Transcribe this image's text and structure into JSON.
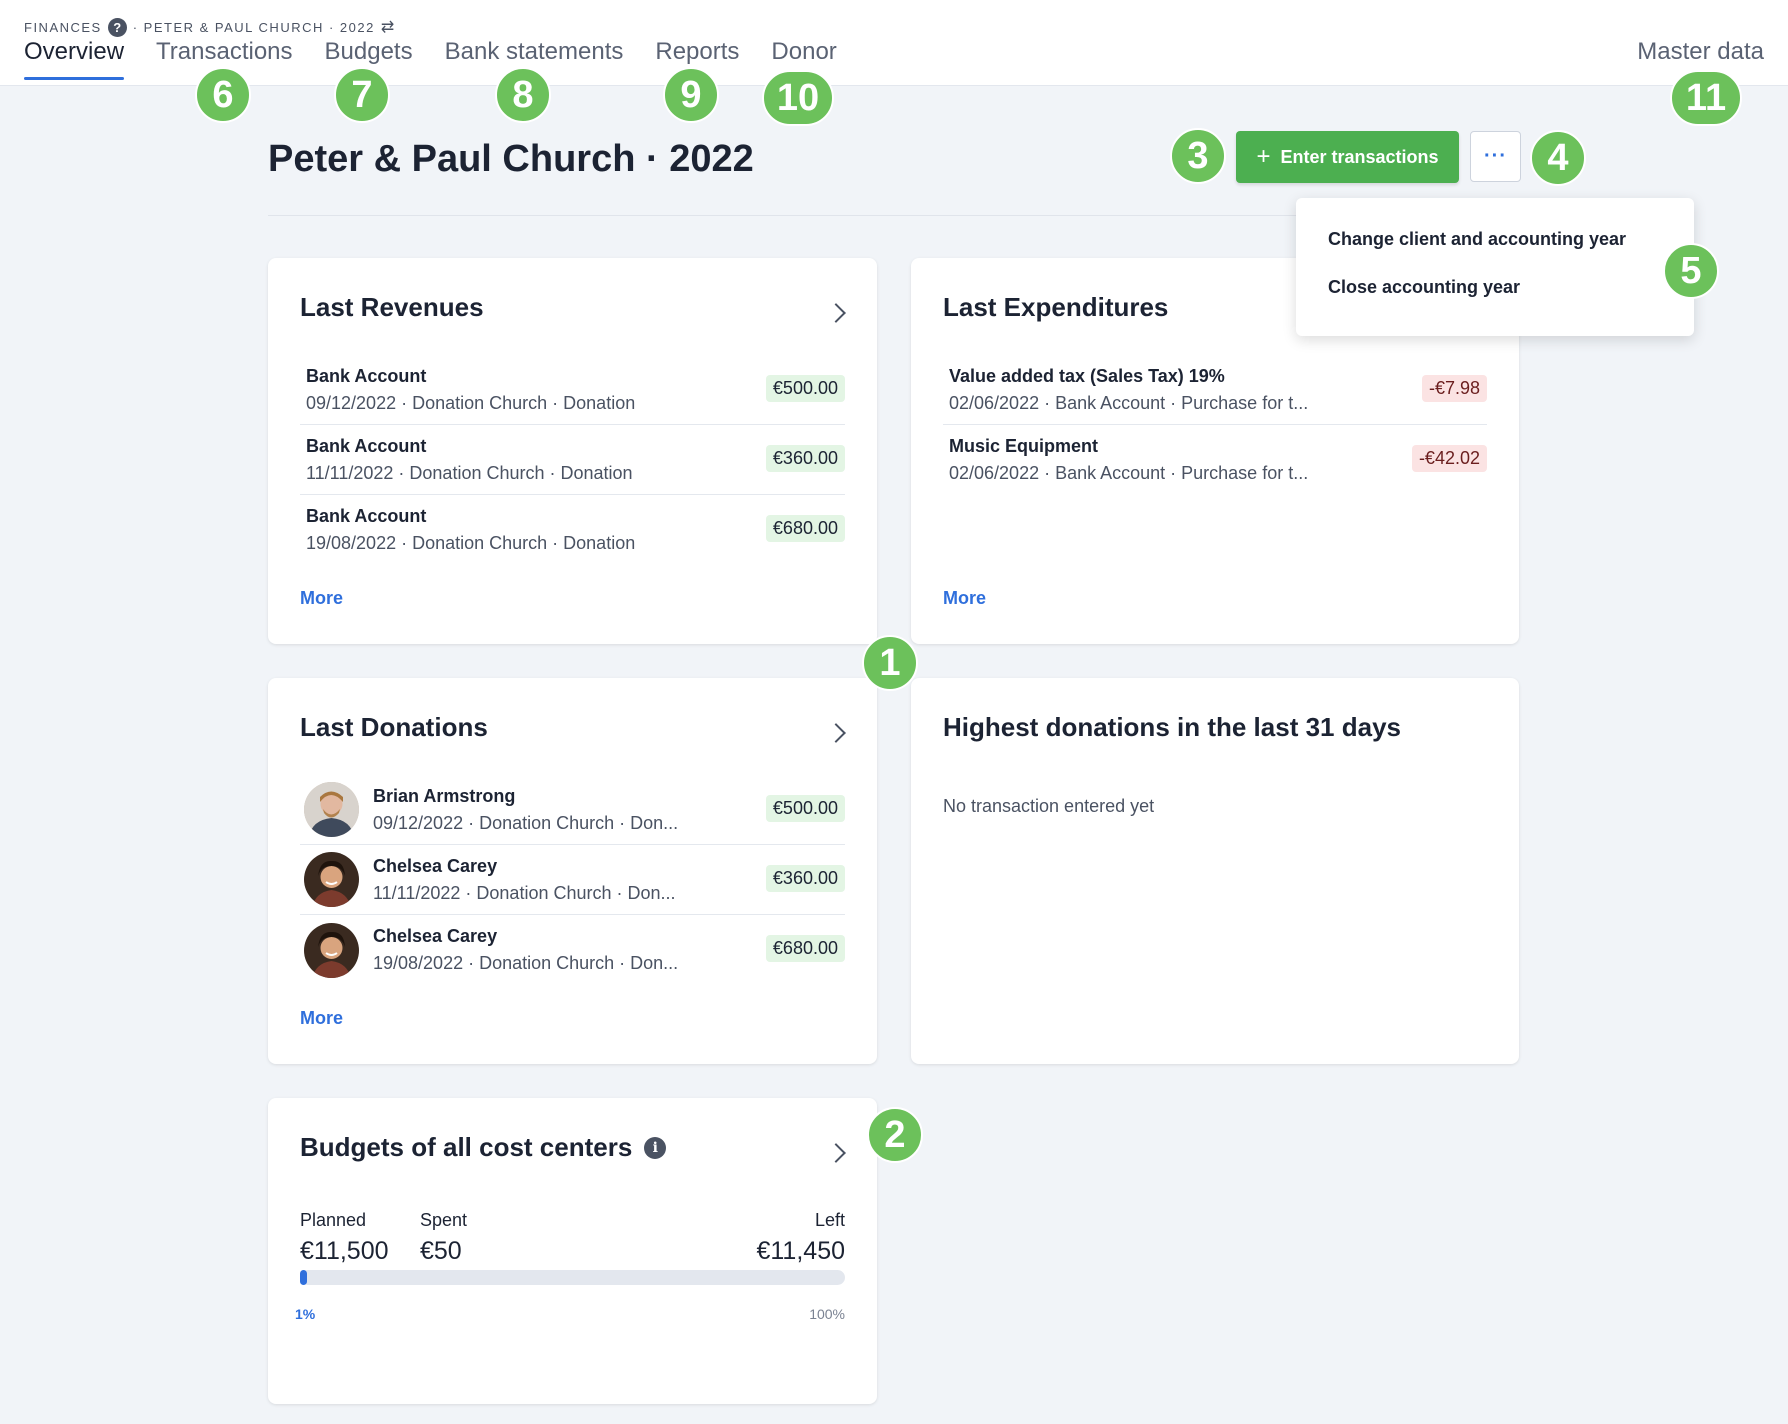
{
  "breadcrumb": {
    "section": "FINANCES",
    "help": "?",
    "client": "· PETER & PAUL CHURCH · 2022",
    "swap": "⇄"
  },
  "nav": {
    "tabs": [
      "Overview",
      "Transactions",
      "Budgets",
      "Bank statements",
      "Reports",
      "Donor"
    ],
    "right": "Master data"
  },
  "header": {
    "title": "Peter & Paul Church · 2022",
    "primary_button": "Enter transactions",
    "plus": "+",
    "more_button": "···"
  },
  "dropdown": {
    "items": [
      "Change client and accounting year",
      "Close accounting year"
    ]
  },
  "revenues": {
    "title": "Last Revenues",
    "rows": [
      {
        "title": "Bank Account",
        "sub": "09/12/2022 · Donation Church · Donation",
        "amount": "€500.00"
      },
      {
        "title": "Bank Account",
        "sub": "11/11/2022 · Donation Church · Donation",
        "amount": "€360.00"
      },
      {
        "title": "Bank Account",
        "sub": "19/08/2022 · Donation Church · Donation",
        "amount": "€680.00"
      }
    ],
    "more": "More"
  },
  "expenditures": {
    "title": "Last Expenditures",
    "rows": [
      {
        "title": "Value added tax (Sales Tax) 19%",
        "sub": "02/06/2022 · Bank Account · Purchase for t...",
        "amount": "-€7.98"
      },
      {
        "title": "Music Equipment",
        "sub": "02/06/2022 · Bank Account · Purchase for t...",
        "amount": "-€42.02"
      }
    ],
    "more": "More"
  },
  "donations": {
    "title": "Last Donations",
    "rows": [
      {
        "title": "Brian Armstrong",
        "sub": "09/12/2022 · Donation Church · Don...",
        "amount": "€500.00"
      },
      {
        "title": "Chelsea Carey",
        "sub": "11/11/2022 · Donation Church · Don...",
        "amount": "€360.00"
      },
      {
        "title": "Chelsea Carey",
        "sub": "19/08/2022 · Donation Church · Don...",
        "amount": "€680.00"
      }
    ],
    "more": "More"
  },
  "highest": {
    "title": "Highest donations in the last 31 days",
    "empty": "No transaction entered yet"
  },
  "budgets": {
    "title": "Budgets of all cost centers",
    "info": "i",
    "planned_label": "Planned",
    "planned_value": "€11,500",
    "spent_label": "Spent",
    "spent_value": "€50",
    "left_label": "Left",
    "left_value": "€11,450",
    "progress_fraction": 0.01,
    "progress_left": "1%",
    "progress_right": "100%"
  },
  "markers": [
    "1",
    "2",
    "3",
    "4",
    "5",
    "6",
    "7",
    "8",
    "9",
    "10",
    "11"
  ],
  "colors": {
    "accent": "#2f6fdc",
    "primary_button": "#4caf50",
    "marker": "#6cc15b",
    "positive_bg": "#e3f5e4",
    "negative_bg": "#fbe3e3"
  }
}
